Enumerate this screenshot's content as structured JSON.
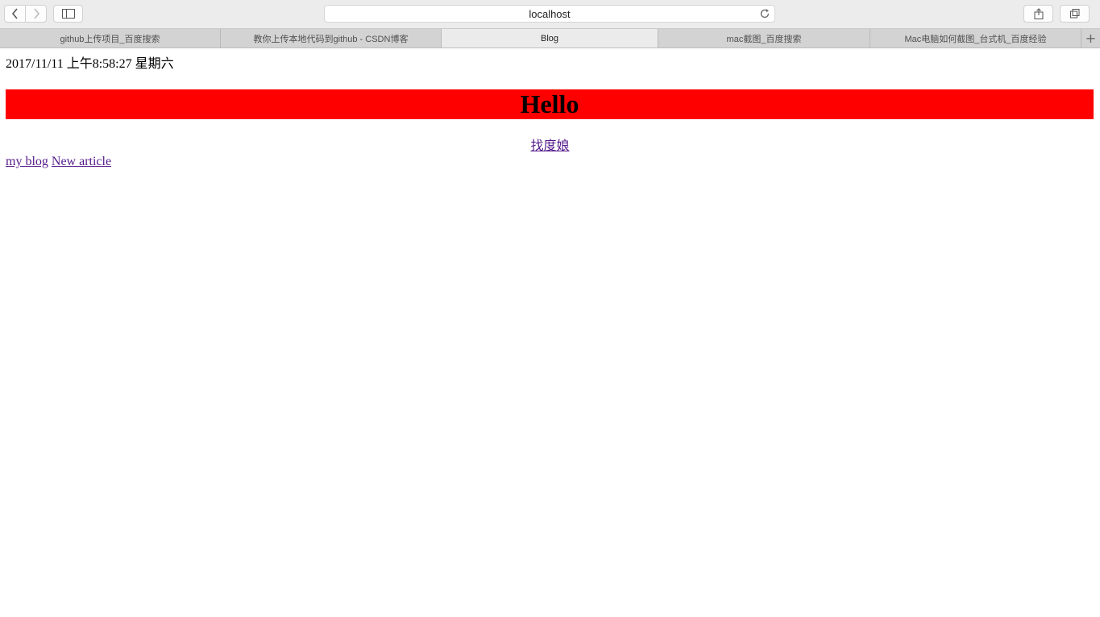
{
  "browser": {
    "address": "localhost",
    "tabs": [
      {
        "label": "github上传项目_百度搜索",
        "active": false
      },
      {
        "label": "教你上传本地代码到github - CSDN博客",
        "active": false
      },
      {
        "label": "Blog",
        "active": true
      },
      {
        "label": "mac截图_百度搜索",
        "active": false
      },
      {
        "label": "Mac电脑如何截图_台式机_百度经验",
        "active": false
      }
    ],
    "icons": [
      "back-icon",
      "forward-icon",
      "sidebar-icon",
      "reload-icon",
      "share-icon",
      "tabs-overview-icon",
      "new-tab-icon"
    ],
    "new_tab_symbol": "+"
  },
  "page": {
    "datetime": "2017/11/11 上午8:58:27 星期六",
    "heading": "Hello",
    "heading_bg": "#ff0000",
    "center_link": "找度娘",
    "links": [
      "my blog",
      "New article"
    ]
  }
}
